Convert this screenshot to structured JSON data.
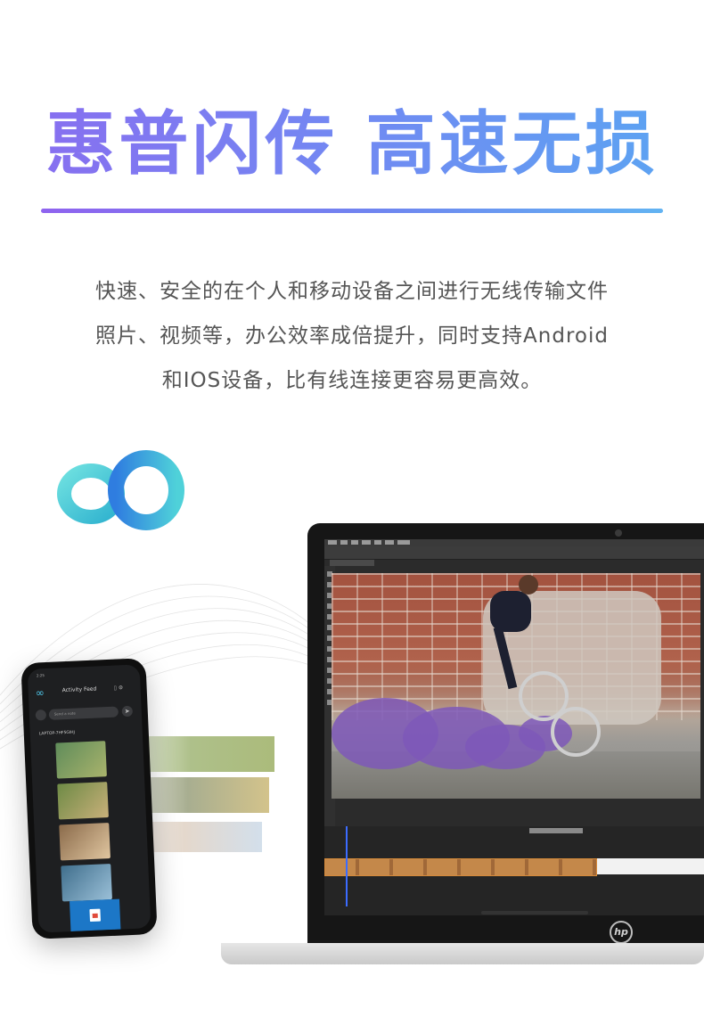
{
  "headline": "惠普闪传  高速无损",
  "description_lines": [
    "快速、安全的在个人和移动设备之间进行无线传输文件",
    "照片、视频等，办公效率成倍提升，同时支持Android",
    "和IOS设备，比有线连接更容易更高效。"
  ],
  "icons": {
    "brand_logo": "infinity-loop-logo-icon",
    "laptop_brand": "hp-logo-icon"
  },
  "colors": {
    "headline_gradient": [
      "#8a6cf0",
      "#5aa6f2"
    ],
    "description_text": "#555555",
    "logo_teal": "#4fd1d9",
    "logo_blue": "#2f7de0"
  },
  "laptop": {
    "brand": "hp"
  },
  "phone": {
    "status_time": "2:25",
    "header_title": "Activity Feed",
    "search_placeholder": "Send a note",
    "device_name": "LAPTOP-7HF5GIHJ"
  }
}
